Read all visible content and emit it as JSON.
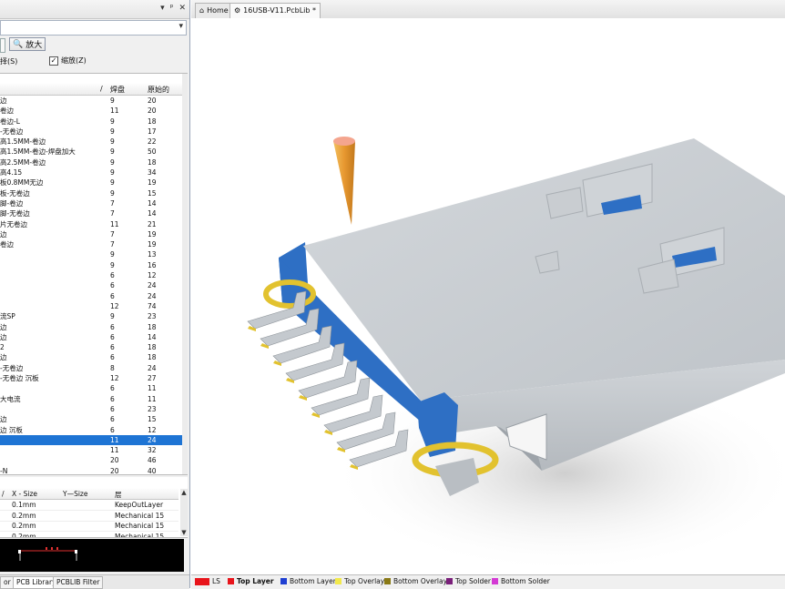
{
  "left_panel": {
    "titlebar_controls": [
      "▾",
      "ᵖ",
      "✕"
    ],
    "zoom_button": "放大",
    "checks": {
      "select": "择(S)",
      "zoom": "缩放(Z)"
    },
    "components": {
      "columns": [
        "/",
        "焊盘",
        "原始的"
      ],
      "rows": [
        {
          "name": "边",
          "pads": "9",
          "prims": "20"
        },
        {
          "name": "卷边",
          "pads": "11",
          "prims": "20"
        },
        {
          "name": "卷边-L",
          "pads": "9",
          "prims": "18"
        },
        {
          "name": "-无卷边",
          "pads": "9",
          "prims": "17"
        },
        {
          "name": "高1.5MM-卷边",
          "pads": "9",
          "prims": "22"
        },
        {
          "name": "高1.5MM-卷边-焊盘加大",
          "pads": "9",
          "prims": "50"
        },
        {
          "name": "高2.5MM-卷边",
          "pads": "9",
          "prims": "18"
        },
        {
          "name": "高4.15",
          "pads": "9",
          "prims": "34"
        },
        {
          "name": "板0.8MM无边",
          "pads": "9",
          "prims": "19"
        },
        {
          "name": "板-无卷边",
          "pads": "9",
          "prims": "15"
        },
        {
          "name": "脚-卷边",
          "pads": "7",
          "prims": "14"
        },
        {
          "name": "脚-无卷边",
          "pads": "7",
          "prims": "14"
        },
        {
          "name": "片无卷边",
          "pads": "11",
          "prims": "21"
        },
        {
          "name": "边",
          "pads": "7",
          "prims": "19"
        },
        {
          "name": "卷边",
          "pads": "7",
          "prims": "19"
        },
        {
          "name": "",
          "pads": "9",
          "prims": "13"
        },
        {
          "name": "",
          "pads": "9",
          "prims": "16"
        },
        {
          "name": "",
          "pads": "6",
          "prims": "12"
        },
        {
          "name": "",
          "pads": "6",
          "prims": "24"
        },
        {
          "name": "",
          "pads": "6",
          "prims": "24"
        },
        {
          "name": "",
          "pads": "12",
          "prims": "74"
        },
        {
          "name": "流SP",
          "pads": "9",
          "prims": "23"
        },
        {
          "name": "边",
          "pads": "6",
          "prims": "18"
        },
        {
          "name": "边",
          "pads": "6",
          "prims": "14"
        },
        {
          "name": "2",
          "pads": "6",
          "prims": "18"
        },
        {
          "name": "边",
          "pads": "6",
          "prims": "18"
        },
        {
          "name": "-无卷边",
          "pads": "8",
          "prims": "24"
        },
        {
          "name": "-无卷边 沉板",
          "pads": "12",
          "prims": "27"
        },
        {
          "name": "",
          "pads": "6",
          "prims": "11"
        },
        {
          "name": "大电流",
          "pads": "6",
          "prims": "11"
        },
        {
          "name": "",
          "pads": "6",
          "prims": "23"
        },
        {
          "name": "边",
          "pads": "6",
          "prims": "15"
        },
        {
          "name": "边 沉板",
          "pads": "6",
          "prims": "12"
        },
        {
          "name": "",
          "pads": "11",
          "prims": "24",
          "selected": true
        },
        {
          "name": "",
          "pads": "11",
          "prims": "32"
        },
        {
          "name": "",
          "pads": "20",
          "prims": "46"
        },
        {
          "name": "-N",
          "pads": "20",
          "prims": "40"
        }
      ]
    },
    "primitives": {
      "columns": [
        "/",
        "X - Size",
        "Y—Size",
        "层"
      ],
      "rows": [
        {
          "x": "0.1mm",
          "y": "",
          "layer": "KeepOutLayer"
        },
        {
          "x": "0.2mm",
          "y": "",
          "layer": "Mechanical 15"
        },
        {
          "x": "0.2mm",
          "y": "",
          "layer": "Mechanical 15"
        },
        {
          "x": "0.2mm",
          "y": "",
          "layer": "Mechanical 15"
        }
      ]
    },
    "tabs": [
      "or",
      "PCB Library",
      "PCBLIB Filter"
    ]
  },
  "doc_tabs": [
    {
      "label": "Home",
      "icon": "home-icon"
    },
    {
      "label": "16USB-V11.PcbLib *",
      "icon": "pcb-icon",
      "active": true
    }
  ],
  "status_bar": {
    "current_layer_label": "LS",
    "layers": [
      {
        "name": "Top Layer",
        "color": "#e8141b",
        "bold": true
      },
      {
        "name": "Bottom Layer",
        "color": "#1f3fd2"
      },
      {
        "name": "Top Overlay",
        "color": "#f2e94b"
      },
      {
        "name": "Bottom Overlay",
        "color": "#8a7a16"
      },
      {
        "name": "Top Solder",
        "color": "#7a1f7a"
      },
      {
        "name": "Bottom Solder",
        "color": "#d43ad4"
      }
    ]
  },
  "colors": {
    "selection": "#1e74d4",
    "body_gray": "#c7ccd1",
    "shell_blue": "#2e6fc4",
    "pad_yellow": "#e2c22f"
  }
}
